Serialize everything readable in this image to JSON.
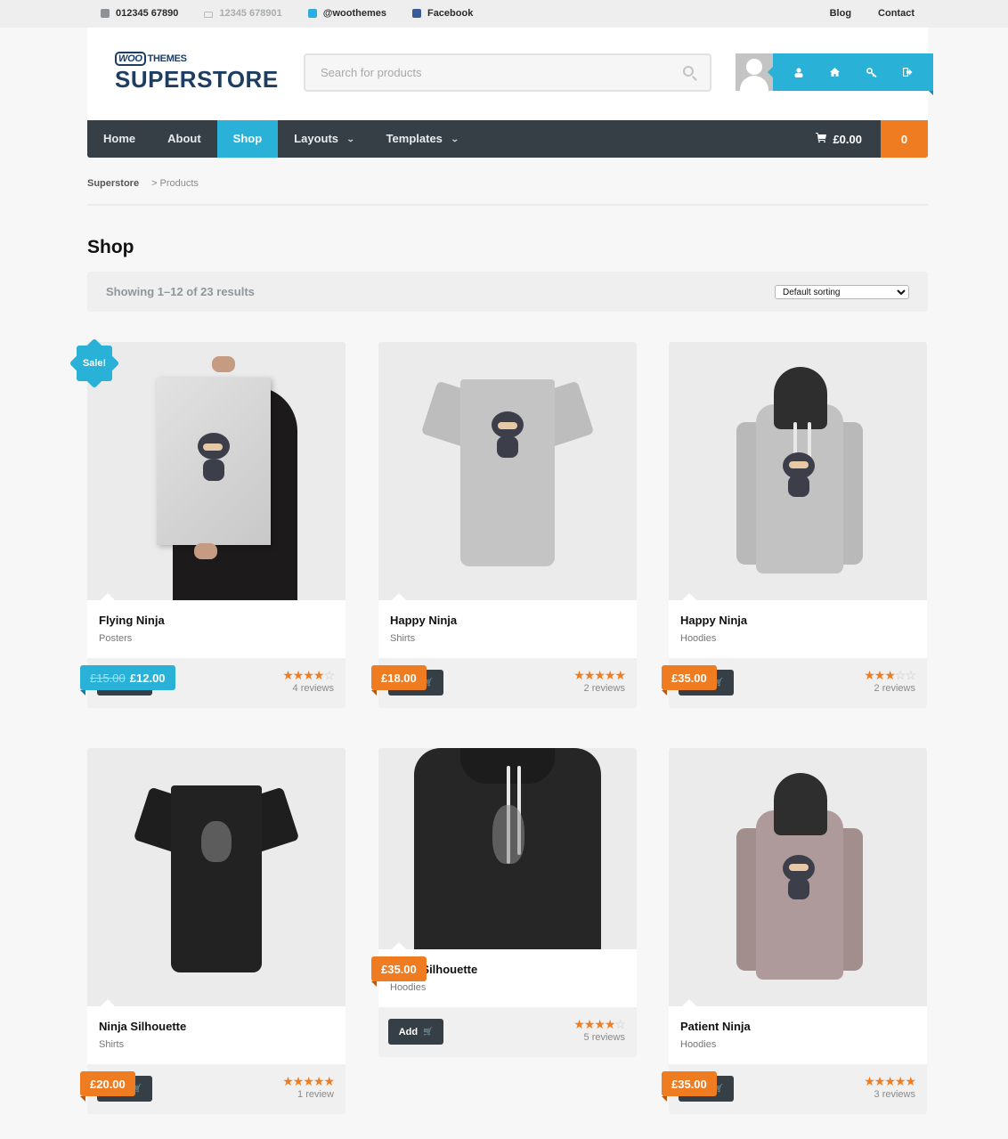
{
  "topbar": {
    "phone": "012345 67890",
    "fax": "12345 678901",
    "twitter": "@woothemes",
    "facebook": "Facebook",
    "links": [
      "Blog",
      "Contact"
    ],
    "icons": [
      "phone-icon",
      "fax-icon",
      "twitter-icon",
      "facebook-icon"
    ]
  },
  "header": {
    "logo_badge": "WOO",
    "logo_sub": "THEMES",
    "logo_name": "SUPERSTORE",
    "search_placeholder": "Search for products",
    "account_icons": [
      "user-icon",
      "home-icon",
      "key-icon",
      "logout-icon"
    ]
  },
  "nav": {
    "items": [
      {
        "label": "Home",
        "active": false,
        "dropdown": false
      },
      {
        "label": "About",
        "active": false,
        "dropdown": false
      },
      {
        "label": "Shop",
        "active": true,
        "dropdown": false
      },
      {
        "label": "Layouts",
        "active": false,
        "dropdown": true
      },
      {
        "label": "Templates",
        "active": false,
        "dropdown": true
      }
    ],
    "cart_total": "£0.00",
    "cart_count": "0"
  },
  "breadcrumb": {
    "home": "Superstore",
    "separator": ">",
    "current": "Products"
  },
  "page": {
    "title": "Shop",
    "result_count": "Showing 1–12 of 23 results",
    "sort_selected": "Default sorting"
  },
  "colors": {
    "accent_blue": "#29b1d8",
    "accent_orange": "#f07c22",
    "nav_dark": "#353f45"
  },
  "products": [
    {
      "name": "Flying Ninja",
      "category": "Posters",
      "price": "£12.00",
      "old_price": "£15.00",
      "sale": true,
      "sale_label": "Sale!",
      "rating": 4,
      "reviews": "4 reviews",
      "add_label": "Add"
    },
    {
      "name": "Happy Ninja",
      "category": "Shirts",
      "price": "£18.00",
      "old_price": null,
      "sale": false,
      "rating": 5,
      "reviews": "2 reviews",
      "add_label": "Add"
    },
    {
      "name": "Happy Ninja",
      "category": "Hoodies",
      "price": "£35.00",
      "old_price": null,
      "sale": false,
      "rating": 3,
      "reviews": "2 reviews",
      "add_label": "Add"
    },
    {
      "name": "Ninja Silhouette",
      "category": "Shirts",
      "price": "£20.00",
      "old_price": null,
      "sale": false,
      "rating": 5,
      "reviews": "1 review",
      "add_label": "Add"
    },
    {
      "name": "Ninja Silhouette",
      "category": "Hoodies",
      "price": "£35.00",
      "old_price": null,
      "sale": false,
      "rating": 4,
      "reviews": "5 reviews",
      "add_label": "Add"
    },
    {
      "name": "Patient Ninja",
      "category": "Hoodies",
      "price": "£35.00",
      "old_price": null,
      "sale": false,
      "rating": 5,
      "reviews": "3 reviews",
      "add_label": "Add"
    }
  ]
}
